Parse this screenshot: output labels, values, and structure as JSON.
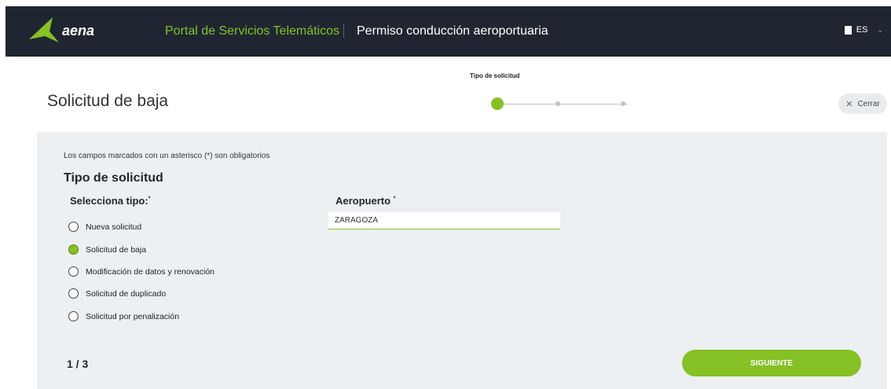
{
  "header": {
    "brand": "aena",
    "portal": "Portal de Servicios Telemáticos",
    "section": "Permiso conducción aeroportuaria",
    "language": "ES"
  },
  "page": {
    "title": "Solicitud de baja",
    "step_label": "Tipo de solicitud",
    "steps_total": 3,
    "current_step": 1,
    "close_label": "Cerrar"
  },
  "form": {
    "required_note": "Los campos marcados con un asterisco (*) son obligatorios",
    "section_title": "Tipo de solicitud",
    "type_label": "Selecciona tipo:",
    "airport_label": "Aeropuerto",
    "required_mark": "*",
    "options": [
      {
        "label": "Nueva solicitud",
        "checked": false
      },
      {
        "label": "Solicitud de baja",
        "checked": true
      },
      {
        "label": "Modificación de datos y renovación",
        "checked": false
      },
      {
        "label": "Solicitud de duplicado",
        "checked": false
      },
      {
        "label": "Solicitud por penalización",
        "checked": false
      }
    ],
    "airport_value": "ZARAGOZA"
  },
  "footer": {
    "pager": "1 / 3",
    "next_label": "SIGUIENTE"
  },
  "colors": {
    "accent": "#86c126",
    "header_bg": "#1f2631",
    "panel_bg": "#edf0f3"
  }
}
